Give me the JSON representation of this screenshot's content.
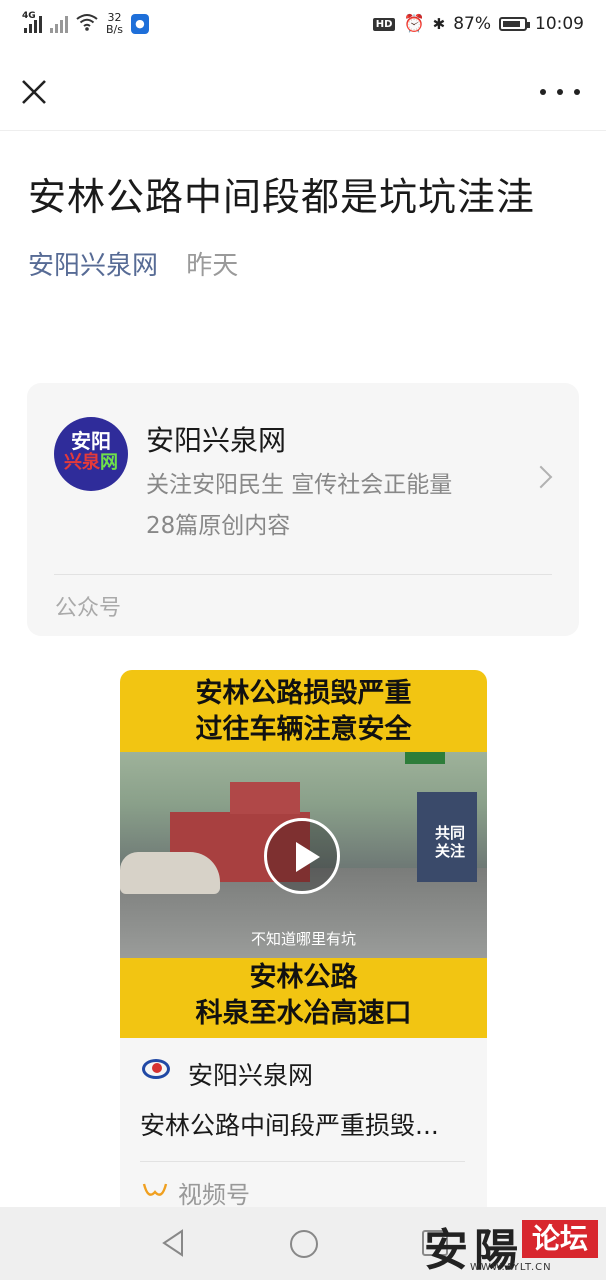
{
  "status_bar": {
    "network": "4G",
    "speed_value": "32",
    "speed_unit": "B/s",
    "hd": "HD",
    "battery": "87%",
    "battery_level": 0.87,
    "time": "10:09"
  },
  "nav": {
    "close_icon": "close-icon",
    "more_icon": "more-icon"
  },
  "article": {
    "title": "安林公路中间段都是坑坑洼洼",
    "author": "安阳兴泉网",
    "date": "昨天"
  },
  "account_card": {
    "avatar_line1": "安阳",
    "avatar_line2a": "兴",
    "avatar_line2b": "泉",
    "avatar_line2c": "网",
    "name": "安阳兴泉网",
    "description": "关注安阳民生 宣传社会正能量",
    "original_count": "28篇原创内容",
    "type": "公众号"
  },
  "video_card": {
    "caption_top_line1": "安林公路损毁严重",
    "caption_top_line2": "过往车辆注意安全",
    "overlay_line1": "共同",
    "overlay_line2": "关注",
    "subtitle": "不知道哪里有坑",
    "caption_bottom_line1": "安林公路",
    "caption_bottom_line2": "科泉至水冶高速口",
    "channel_name": "安阳兴泉网",
    "video_title": "安林公路中间段严重损毁...",
    "type": "视频号",
    "accent_color": "#f2c512"
  },
  "watermark": {
    "han": "安陽",
    "box": "论坛",
    "url": "WWW.AYLT.CN"
  }
}
